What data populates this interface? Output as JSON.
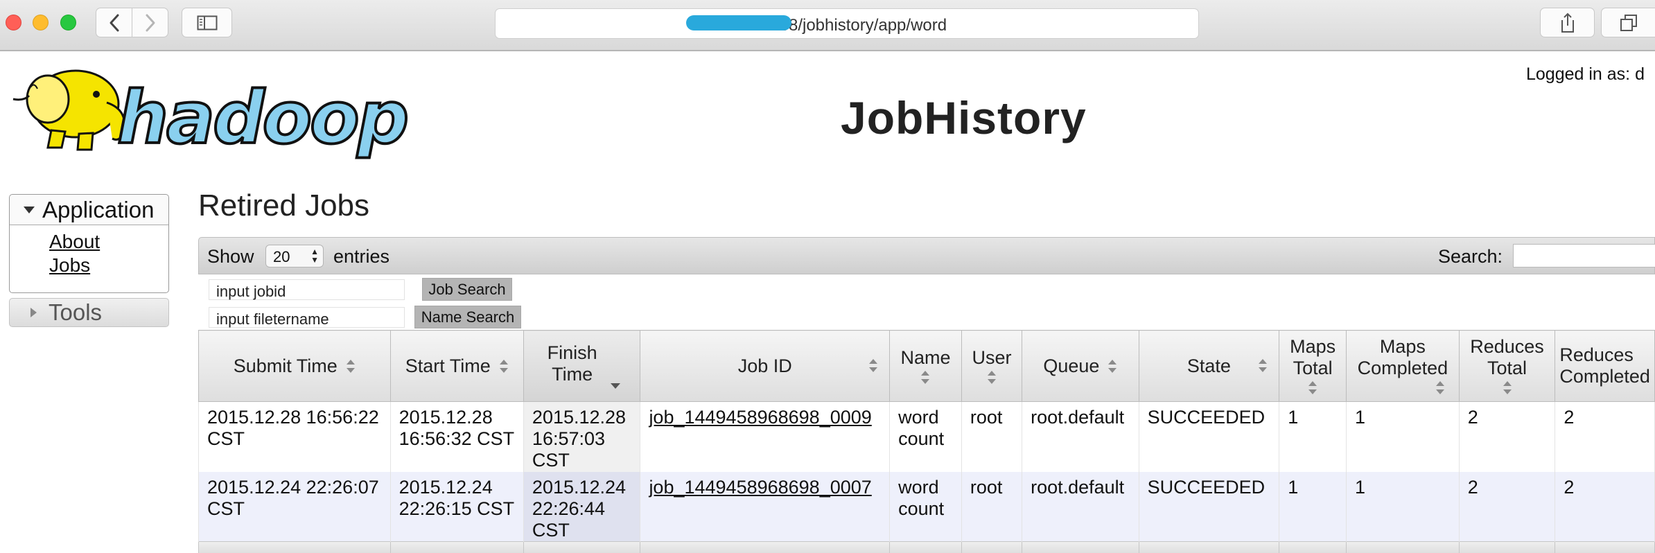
{
  "browser": {
    "url_suffix": ".19888/jobhistory/app/word"
  },
  "header": {
    "title": "JobHistory",
    "logged_in": "Logged in as: d"
  },
  "nav": {
    "application_label": "Application",
    "links": [
      "About",
      "Jobs"
    ],
    "tools_label": "Tools"
  },
  "main": {
    "section_title": "Retired Jobs",
    "show_label": "Show",
    "page_size": "20",
    "entries_label": "entries",
    "search_label": "Search:",
    "search_value": "",
    "jobid_input": "input jobid",
    "job_search_button": "Job Search",
    "filename_input": "input filetername",
    "name_search_button": "Name Search"
  },
  "table": {
    "columns": [
      "Submit Time",
      "Start Time",
      "Finish Time",
      "Job ID",
      "Name",
      "User",
      "Queue",
      "State",
      "Maps Total",
      "Maps Completed",
      "Reduces Total",
      "Reduces Completed"
    ],
    "rows": [
      {
        "submit_time": "2015.12.28 16:56:22 CST",
        "start_time": "2015.12.28 16:56:32 CST",
        "finish_time": "2015.12.28 16:57:03 CST",
        "job_id": "job_1449458968698_0009",
        "name": "word count",
        "user": "root",
        "queue": "root.default",
        "state": "SUCCEEDED",
        "maps_total": "1",
        "maps_completed": "1",
        "reduces_total": "2",
        "reduces_completed": "2"
      },
      {
        "submit_time": "2015.12.24 22:26:07 CST",
        "start_time": "2015.12.24 22:26:15 CST",
        "finish_time": "2015.12.24 22:26:44 CST",
        "job_id": "job_1449458968698_0007",
        "name": "word count",
        "user": "root",
        "queue": "root.default",
        "state": "SUCCEEDED",
        "maps_total": "1",
        "maps_completed": "1",
        "reduces_total": "2",
        "reduces_completed": "2"
      }
    ]
  },
  "colors": {
    "url_redaction": "#29a9dc",
    "logo_yellow": "#f5e400",
    "logo_blue": "#8ad0ef",
    "row_alt": "#eef0fb"
  },
  "icons": [
    "back-icon",
    "forward-icon",
    "sidebar-icon",
    "reload-icon",
    "share-icon",
    "tabs-icon",
    "hadoop-logo",
    "sort-icon"
  ]
}
